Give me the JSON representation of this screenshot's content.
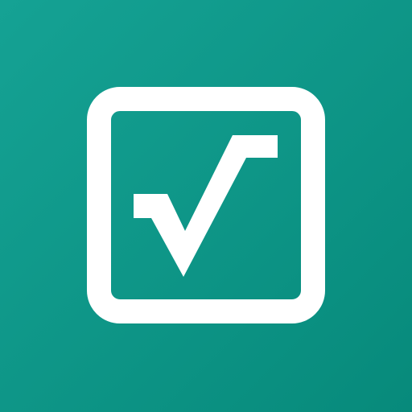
{
  "app_icon": {
    "name": "square-root-icon",
    "colors": {
      "background_start": "#15a294",
      "background_end": "#078a7b",
      "foreground": "#ffffff"
    }
  }
}
